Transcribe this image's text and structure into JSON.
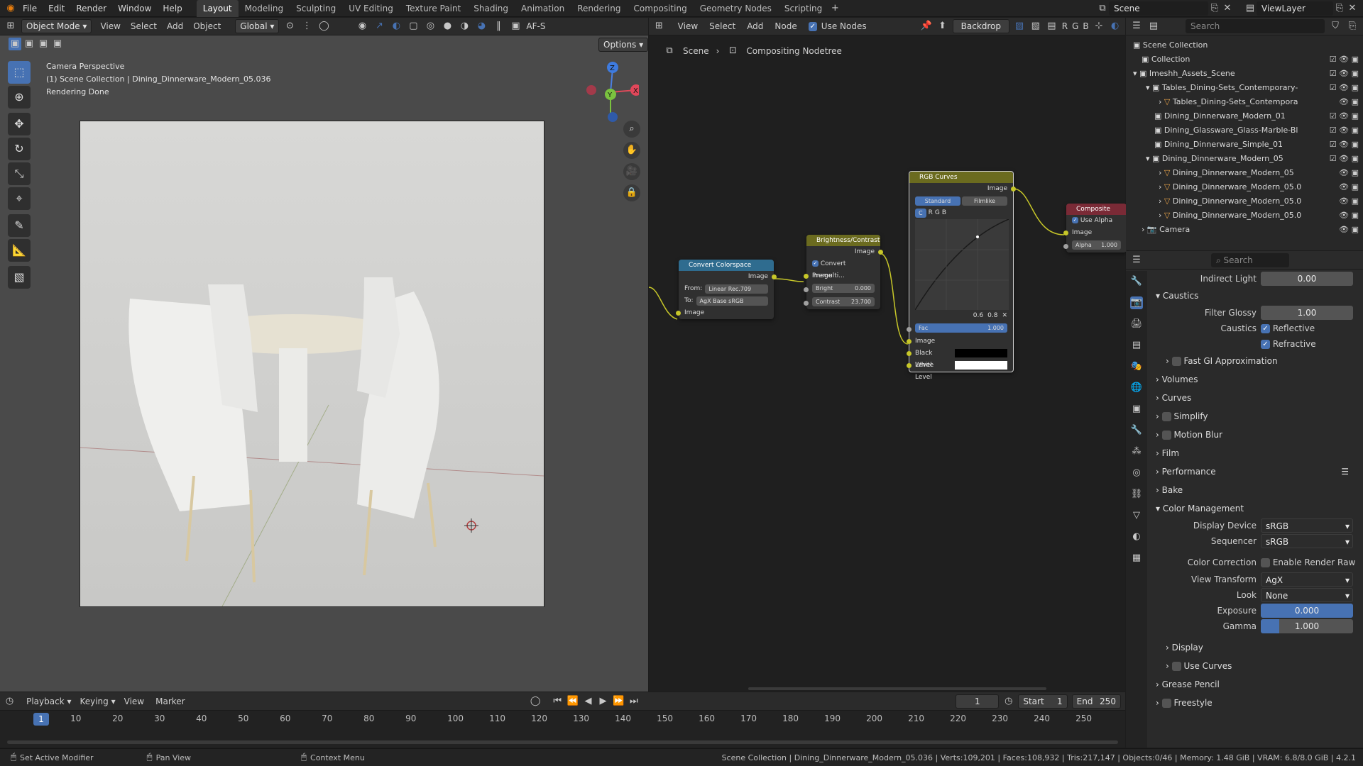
{
  "menus": [
    "File",
    "Edit",
    "Render",
    "Window",
    "Help"
  ],
  "workspaces": [
    "Layout",
    "Modeling",
    "Sculpting",
    "UV Editing",
    "Texture Paint",
    "Shading",
    "Animation",
    "Rendering",
    "Compositing",
    "Geometry Nodes",
    "Scripting"
  ],
  "active_workspace": "Layout",
  "scene_name": "Scene",
  "view_layer": "ViewLayer",
  "viewport": {
    "mode": "Object Mode",
    "menus": [
      "View",
      "Select",
      "Add",
      "Object"
    ],
    "transform_orientation": "Global",
    "options": "Options",
    "af": "AF-S",
    "overlay_lines": [
      "Camera Perspective",
      "(1) Scene Collection | Dining_Dinnerware_Modern_05.036",
      "Rendering Done"
    ],
    "gizmo": {
      "x": "X",
      "y": "Y",
      "z": "Z"
    }
  },
  "node_editor": {
    "menus": [
      "View",
      "Select",
      "Add",
      "Node"
    ],
    "use_nodes_label": "Use Nodes",
    "backdrop": "Backdrop",
    "channels": [
      "R",
      "G",
      "B"
    ],
    "breadcrumb": [
      "Scene",
      "Compositing Nodetree"
    ],
    "nodes": {
      "convert": {
        "title": "Convert Colorspace",
        "out": "Image",
        "from_label": "From:",
        "from": "Linear Rec.709",
        "to_label": "To:",
        "to": "AgX Base sRGB",
        "in": "Image"
      },
      "bc": {
        "title": "Brightness/Contrast",
        "out": "Image",
        "premul": "Convert Premulti...",
        "in": "Image",
        "bright_label": "Bright",
        "bright": "0.000",
        "contrast_label": "Contrast",
        "contrast": "23.700"
      },
      "curves": {
        "title": "RGB Curves",
        "out": "Image",
        "tabs": [
          "Standard",
          "Filmlike"
        ],
        "channels": [
          "C",
          "R",
          "G",
          "B"
        ],
        "x": "0.6",
        "y": "0.8",
        "fac_label": "Fac",
        "fac": "1.000",
        "in": "Image",
        "black": "Black Level",
        "white": "White Level"
      },
      "composite": {
        "title": "Composite",
        "use_alpha": "Use Alpha",
        "in": "Image",
        "alpha_label": "Alpha",
        "alpha": "1.000"
      }
    }
  },
  "outliner": {
    "search_placeholder": "Search",
    "items": [
      {
        "label": "Scene Collection"
      },
      {
        "label": "Collection"
      },
      {
        "label": "Imeshh_Assets_Scene"
      },
      {
        "label": "Tables_Dining-Sets_Contemporary-"
      },
      {
        "label": "Tables_Dining-Sets_Contempora"
      },
      {
        "label": "Dining_Dinnerware_Modern_01"
      },
      {
        "label": "Dining_Glassware_Glass-Marble-Bl"
      },
      {
        "label": "Dining_Dinnerware_Simple_01"
      },
      {
        "label": "Dining_Dinnerware_Modern_05"
      },
      {
        "label": "Dining_Dinnerware_Modern_05"
      },
      {
        "label": "Dining_Dinnerware_Modern_05.0"
      },
      {
        "label": "Dining_Dinnerware_Modern_05.0"
      },
      {
        "label": "Dining_Dinnerware_Modern_05.0"
      },
      {
        "label": "Camera"
      }
    ]
  },
  "properties": {
    "search_placeholder": "Search",
    "indirect_light_label": "Indirect Light",
    "indirect_light": "0.00",
    "caustics_panel": "Caustics",
    "filter_glossy_label": "Filter Glossy",
    "filter_glossy": "1.00",
    "caustics_label": "Caustics",
    "reflective": "Reflective",
    "refractive": "Refractive",
    "fast_gi": "Fast GI Approximation",
    "panels": [
      "Volumes",
      "Curves",
      "Simplify",
      "Motion Blur",
      "Film",
      "Performance",
      "Bake"
    ],
    "color_management": "Color Management",
    "display_device_label": "Display Device",
    "display_device": "sRGB",
    "sequencer_label": "Sequencer",
    "sequencer": "sRGB",
    "color_correction_label": "Color Correction",
    "enable_render_raw": "Enable Render Raw",
    "view_transform_label": "View Transform",
    "view_transform": "AgX",
    "look_label": "Look",
    "look": "None",
    "exposure_label": "Exposure",
    "exposure": "0.000",
    "gamma_label": "Gamma",
    "gamma": "1.000",
    "sub_panels": [
      "Display",
      "Use Curves"
    ],
    "bottom_panels": [
      "Grease Pencil",
      "Freestyle"
    ]
  },
  "timeline": {
    "menus": [
      "Playback",
      "Keying",
      "View",
      "Marker"
    ],
    "current_frame": "1",
    "start_label": "Start",
    "start": "1",
    "end_label": "End",
    "end": "250",
    "ticks": [
      "1",
      "10",
      "20",
      "30",
      "40",
      "50",
      "60",
      "70",
      "80",
      "90",
      "100",
      "110",
      "120",
      "130",
      "140",
      "150",
      "160",
      "170",
      "180",
      "190",
      "200",
      "210",
      "220",
      "230",
      "240",
      "250"
    ]
  },
  "statusbar": {
    "left": [
      "Set Active Modifier",
      "Pan View",
      "Context Menu"
    ],
    "info": "Scene Collection | Dining_Dinnerware_Modern_05.036 | Verts:109,201 | Faces:108,932 | Tris:217,147 | Objects:0/46 | Memory: 1.48 GiB | VRAM: 6.8/8.0 GiB | 4.2.1"
  },
  "colors": {
    "accent": "#4772b3",
    "socket": "#c7c729",
    "node_convert": "#2f6c8f",
    "node_color": "#6b6b1f",
    "node_output": "#7a2a36"
  }
}
